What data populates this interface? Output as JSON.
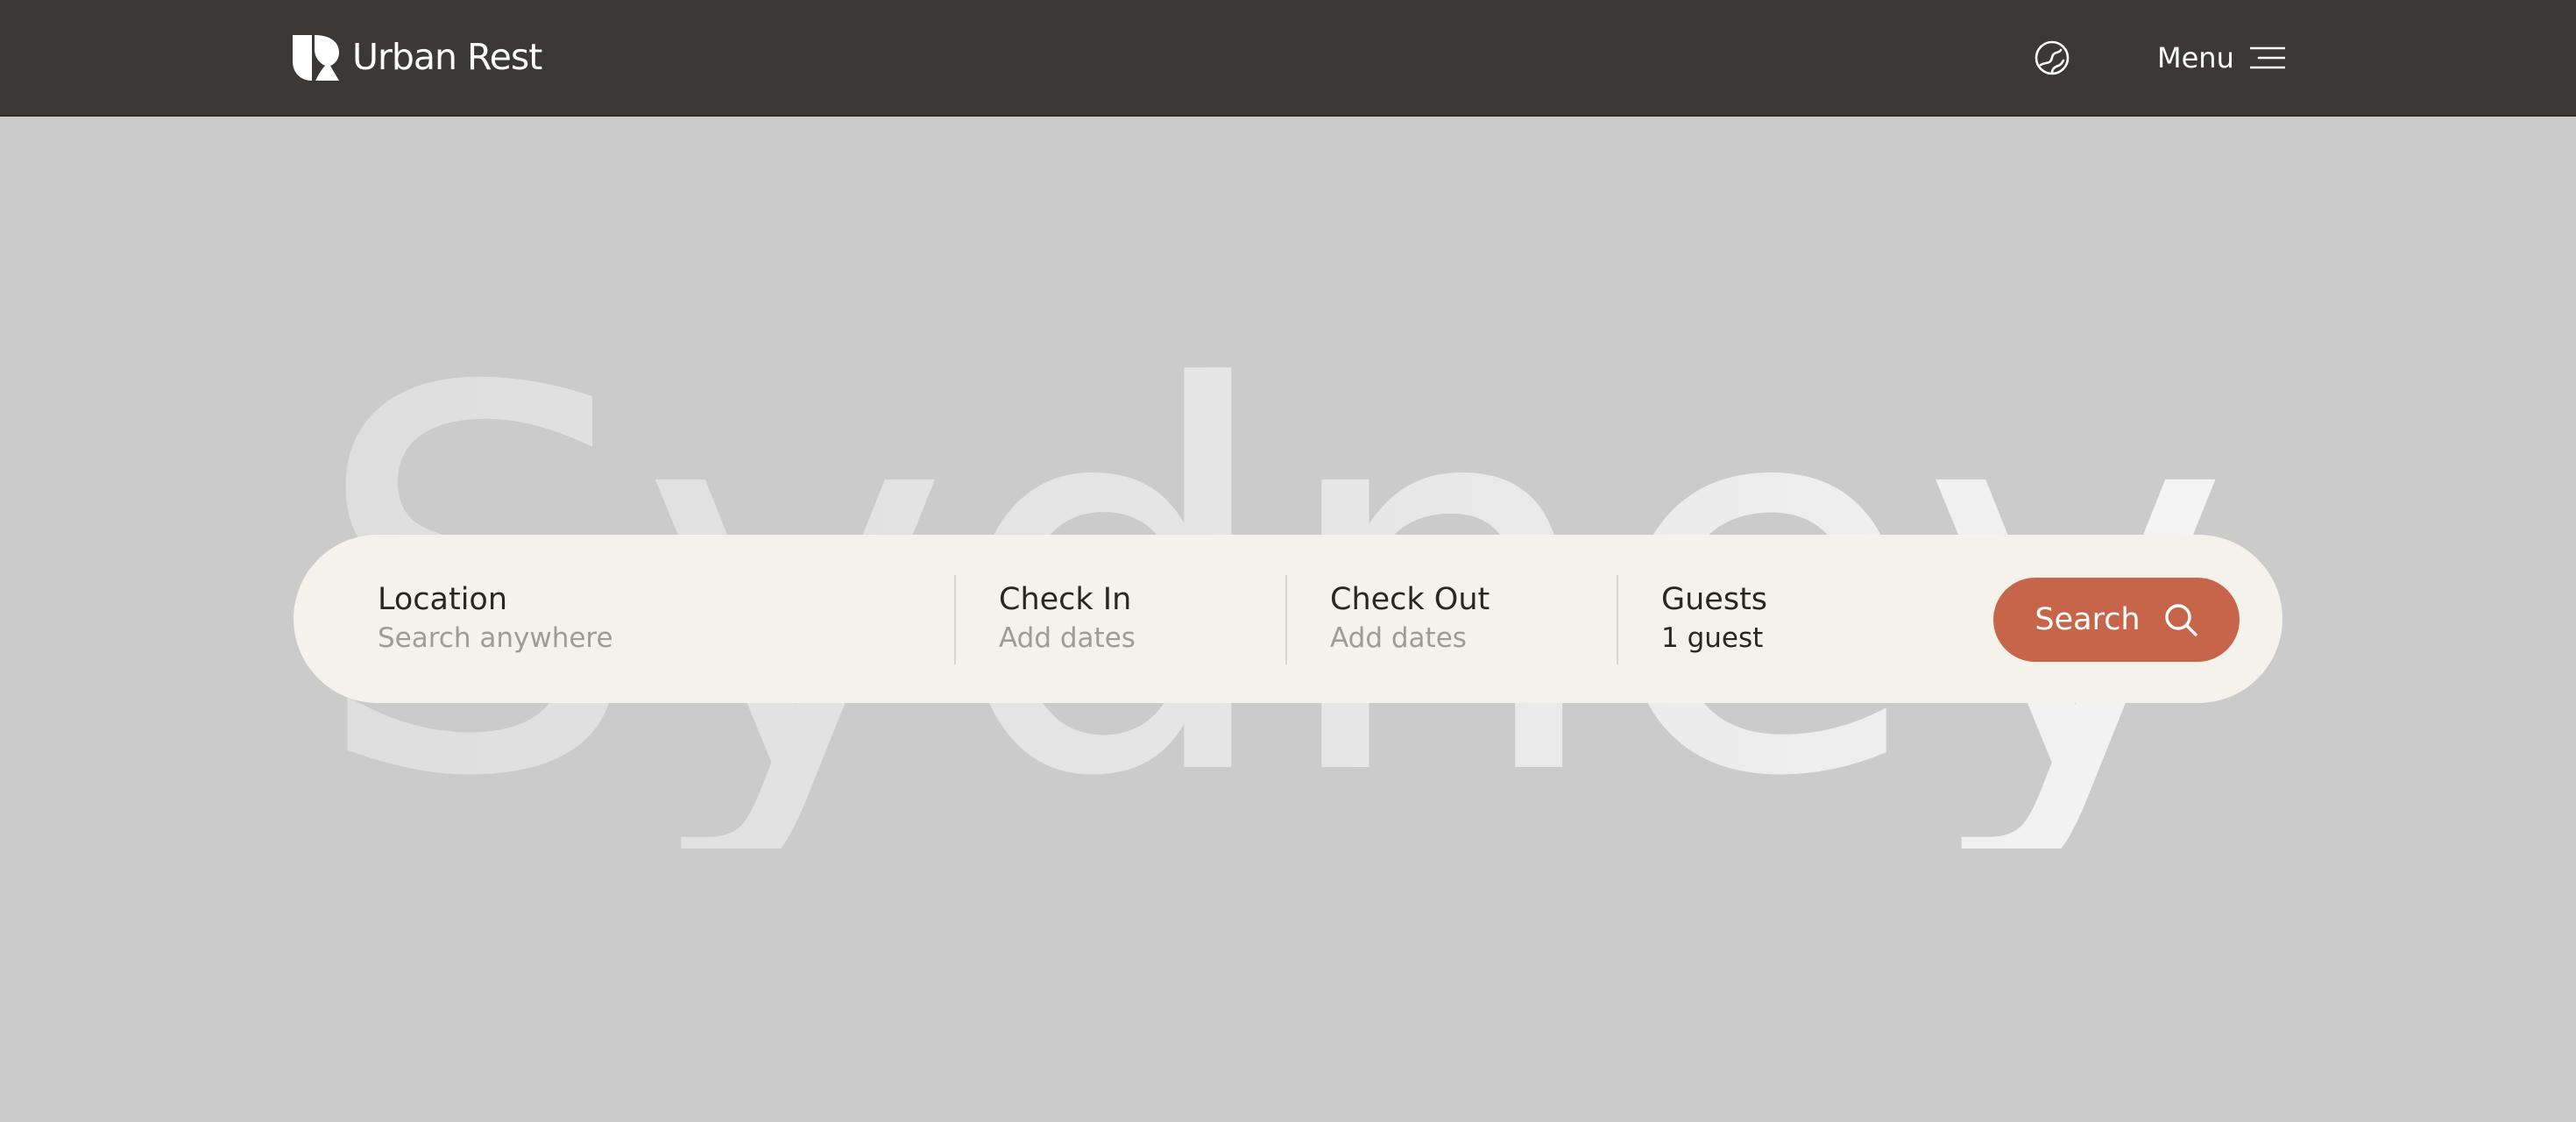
{
  "header": {
    "brand_name": "Urban Rest",
    "menu_label": "Menu",
    "icons": {
      "logo": "urban-rest-logo",
      "language": "globe-icon",
      "menu": "hamburger-menu-icon"
    }
  },
  "hero": {
    "city": "Sydney"
  },
  "search": {
    "location": {
      "label": "Location",
      "placeholder": "Search anywhere"
    },
    "check_in": {
      "label": "Check In",
      "placeholder": "Add dates"
    },
    "check_out": {
      "label": "Check Out",
      "placeholder": "Add dates"
    },
    "guests": {
      "label": "Guests",
      "value": "1 guest"
    },
    "button_label": "Search",
    "button_icon": "search-icon"
  },
  "colors": {
    "header_bg": "#3c3835",
    "page_bg": "#cbcbcb",
    "search_bar_bg": "#f5f1eb",
    "accent": "#c7654a",
    "text_dark": "#2b2623",
    "text_muted": "#a19b95"
  }
}
